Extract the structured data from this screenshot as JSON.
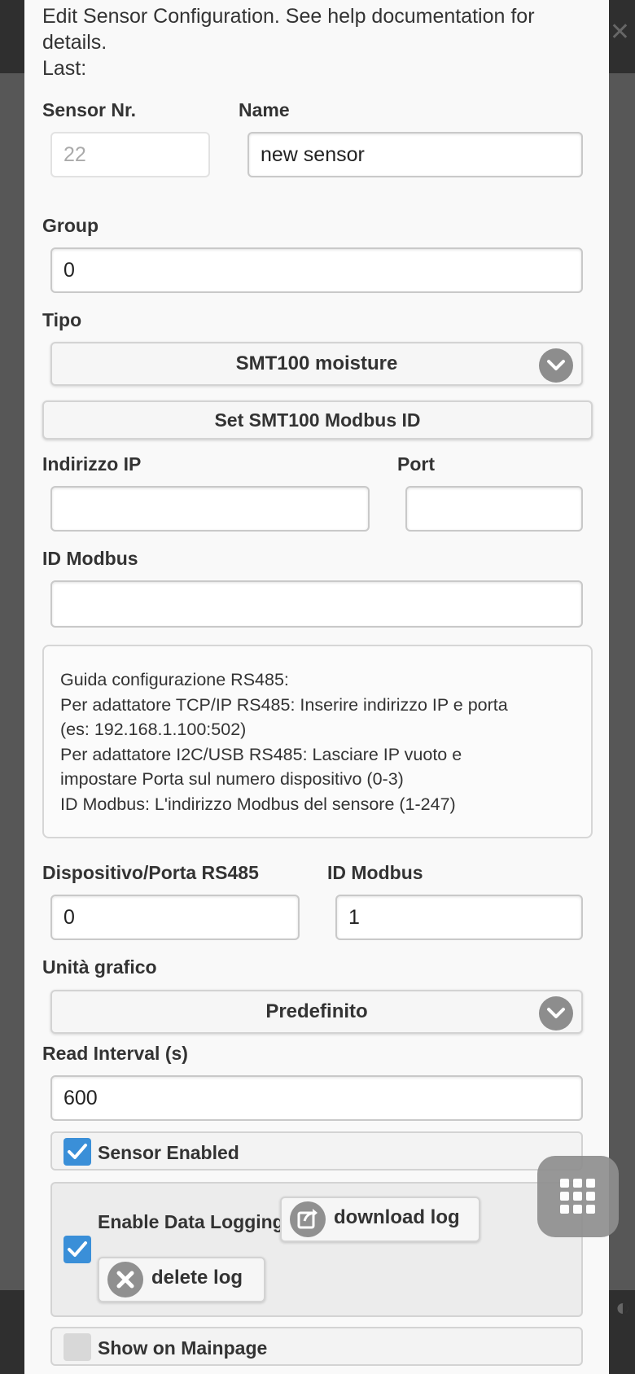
{
  "description": {
    "line1": "Edit Sensor Configuration. See help documentation for details.",
    "line2": "Last:"
  },
  "form": {
    "sensor_nr_label": "Sensor Nr.",
    "sensor_nr_value": "22",
    "name_label": "Name",
    "name_value": "new sensor",
    "group_label": "Group",
    "group_value": "0",
    "tipo_label": "Tipo",
    "tipo_selected": "SMT100 moisture",
    "set_modbus_button": "Set SMT100 Modbus ID",
    "ip_label": "Indirizzo IP",
    "ip_value": "",
    "port_label": "Port",
    "port_value": "",
    "modbus_id_label": "ID Modbus",
    "modbus_id_value": "",
    "help_lines": [
      "Guida configurazione RS485:",
      "Per adattatore TCP/IP RS485: Inserire indirizzo IP e porta",
      "(es: 192.168.1.100:502)",
      "Per adattatore I2C/USB RS485: Lasciare IP vuoto e",
      "impostare Porta sul numero dispositivo (0-3)",
      "ID Modbus: L'indirizzo Modbus del sensore (1-247)"
    ],
    "rs485_port_label": "Dispositivo/Porta RS485",
    "rs485_port_value": "0",
    "rs485_modbus_label": "ID Modbus",
    "rs485_modbus_value": "1",
    "unit_label": "Unità grafico",
    "unit_selected": "Predefinito",
    "interval_label": "Read Interval (s)",
    "interval_value": "600",
    "sensor_enabled_label": "Sensor Enabled",
    "sensor_enabled": true,
    "logging_label": "Enable Data Logging",
    "logging_enabled": true,
    "download_log_label": "download log",
    "delete_log_label": "delete log",
    "mainpage_label": "Show on Mainpage",
    "mainpage_enabled": false
  },
  "colors": {
    "checkbox_on": "#3a8fd8",
    "checkbox_off": "#d8d8d8",
    "icon_grey": "#909090"
  },
  "icons": {
    "select_arrow": "chevron-down-icon",
    "download": "share-icon",
    "delete": "close-icon",
    "fab": "grid-icon"
  }
}
